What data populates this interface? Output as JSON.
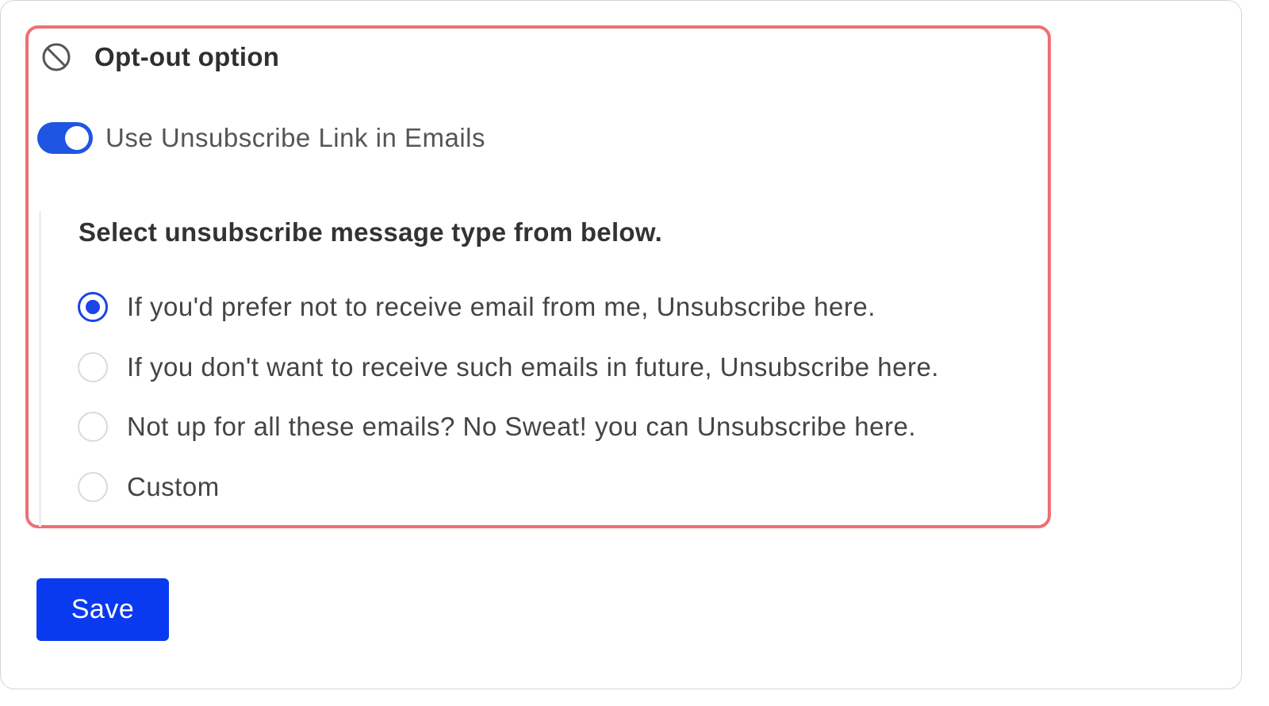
{
  "opt_out": {
    "title": "Opt-out option",
    "icon": "ban-icon",
    "toggle": {
      "label": "Use Unsubscribe Link in Emails",
      "on": true,
      "color": "#1f55e3"
    },
    "message_type_heading": "Select unsubscribe message type from below.",
    "options": [
      {
        "label": "If you'd prefer not to receive email from me, Unsubscribe here.",
        "selected": true
      },
      {
        "label": "If you don't want to receive such emails in future, Unsubscribe here.",
        "selected": false
      },
      {
        "label": "Not up for all these emails? No Sweat! you can Unsubscribe here.",
        "selected": false
      },
      {
        "label": "Custom",
        "selected": false
      }
    ],
    "highlight_color": "#ee6f73"
  },
  "save_button": {
    "label": "Save",
    "color": "#0a3af0"
  }
}
